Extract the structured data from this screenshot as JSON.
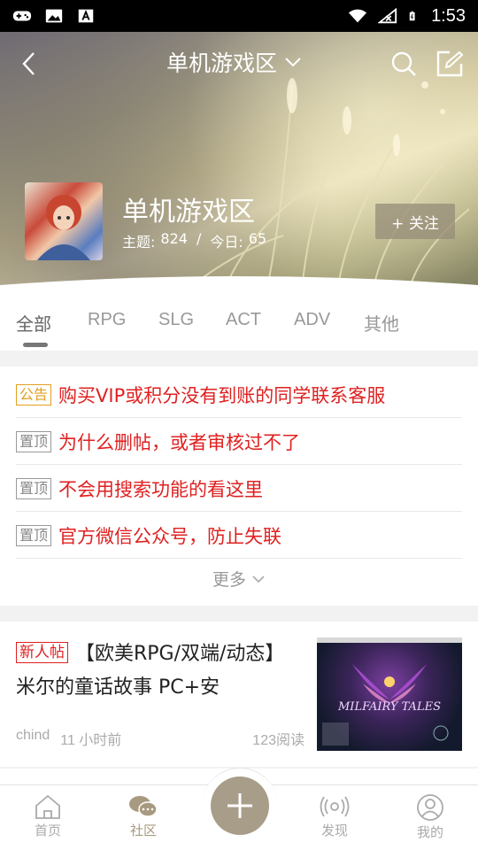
{
  "status_bar": {
    "time": "1:53",
    "icons": [
      "gamepad-icon",
      "image-icon",
      "font-icon",
      "wifi-icon",
      "signal-icon",
      "battery-icon"
    ]
  },
  "header": {
    "title": "单机游戏区"
  },
  "forum": {
    "name": "单机游戏区",
    "topics_label": "主题:",
    "topics_count": "824",
    "separator": "/",
    "today_label": "今日:",
    "today_count": "65",
    "follow_label": "+ 关注"
  },
  "tabs": [
    "全部",
    "RPG",
    "SLG",
    "ACT",
    "ADV",
    "其他"
  ],
  "active_tab": "全部",
  "pinned": [
    {
      "tag": "公告",
      "text": "购买VIP或积分没有到账的同学联系客服"
    },
    {
      "tag": "置顶",
      "text": "为什么删帖，或者审核过不了"
    },
    {
      "tag": "置顶",
      "text": "不会用搜索功能的看这里"
    },
    {
      "tag": "置顶",
      "text": "官方微信公众号，防止失联"
    }
  ],
  "more_label": "更多",
  "posts": [
    {
      "tag": "新人帖",
      "title": "【欧美RPG/双端/动态】米尔的童话故事 PC+安",
      "author": "chind",
      "time": "11 小时前",
      "reads": "123阅读",
      "thumb_text": "MILFAIRY TALES"
    }
  ],
  "bottom_nav": {
    "home": "首页",
    "community": "社区",
    "discover": "发现",
    "mine": "我的"
  },
  "colors": {
    "accent": "#a89d89",
    "red": "#e02020",
    "notice": "#e0a020"
  }
}
